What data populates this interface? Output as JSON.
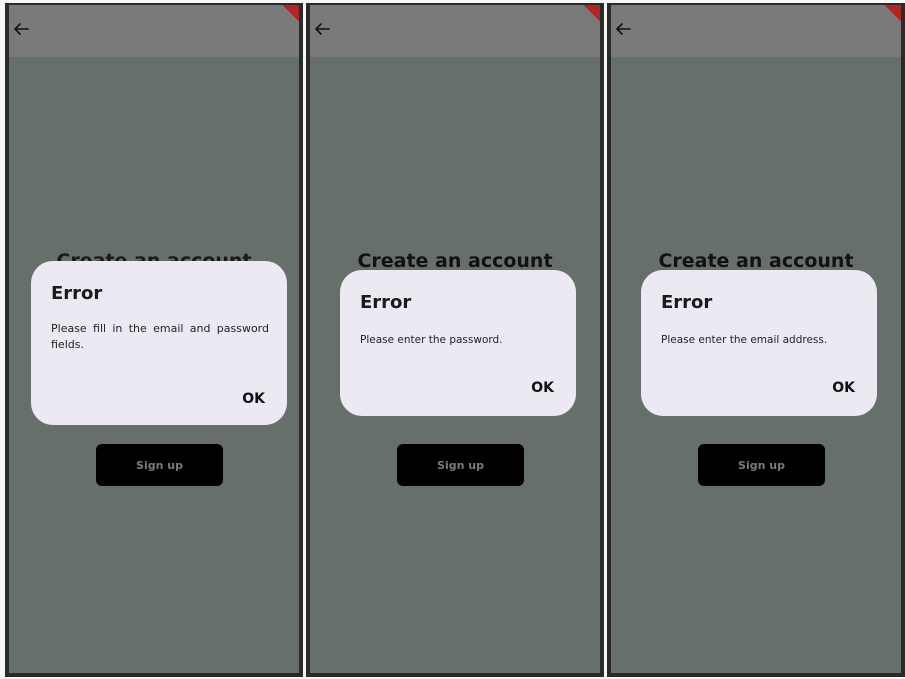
{
  "screens": [
    {
      "page_title": "Create an account",
      "dialog": {
        "title": "Error",
        "message": "Please fill in the email and password fields.",
        "ok_label": "OK"
      },
      "signup_label": "Sign up"
    },
    {
      "page_title": "Create an account",
      "dialog": {
        "title": "Error",
        "message": "Please enter the password.",
        "ok_label": "OK"
      },
      "signup_label": "Sign up"
    },
    {
      "page_title": "Create an account",
      "dialog": {
        "title": "Error",
        "message": "Please enter the email address.",
        "ok_label": "OK"
      },
      "signup_label": "Sign up"
    }
  ],
  "icons": {
    "back": "arrow-left-icon",
    "debug_banner": "debug-banner"
  },
  "colors": {
    "scrim_background": "#676f6a",
    "app_bar": "#7a7a7a",
    "dialog_background": "#ede9f3",
    "button_background": "#000000",
    "button_text": "#7a7a7a"
  }
}
